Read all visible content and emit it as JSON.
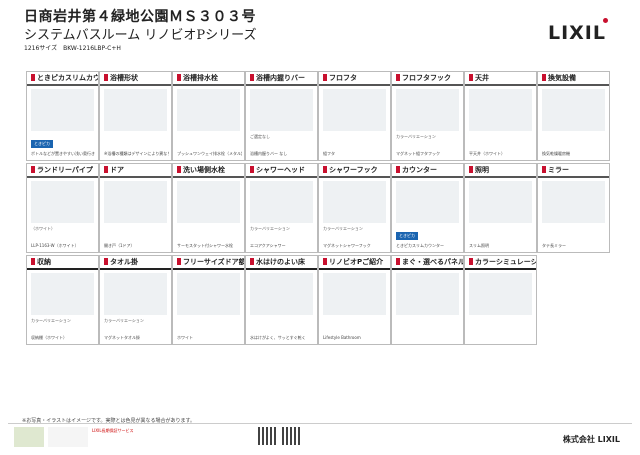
{
  "header": {
    "line1": "日商岩井第４緑地公園ＭＳ３０３号",
    "line2": "システムバスルーム リノビオPシリーズ",
    "line3": "1216サイズ　BKW-1216LBP-C+H",
    "logo": "LIXIL"
  },
  "cards": [
    {
      "title": "ときピカスリムカウンター",
      "caption": "ボトルなどが置きやすい浅い奥行き",
      "cap2": "",
      "tag": "ときピカ"
    },
    {
      "title": "浴槽形状",
      "caption": "※浴槽の種類はデザインにより異なります",
      "cap2": "",
      "tag": ""
    },
    {
      "title": "浴槽排水栓",
      "caption": "プッシュワンウェイ排水栓（メタル調）",
      "cap2": "",
      "tag": ""
    },
    {
      "title": "浴槽内握りバー",
      "caption": "浴槽内握りバー なし",
      "cap2": "ご選定なし",
      "tag": ""
    },
    {
      "title": "フロフタ",
      "caption": "組フタ",
      "cap2": "",
      "tag": ""
    },
    {
      "title": "フロフタフック",
      "caption": "マグネット組フタフック",
      "cap2": "カラーバリエーション",
      "tag": ""
    },
    {
      "title": "天井",
      "caption": "平天井（ホワイト）",
      "cap2": "",
      "tag": ""
    },
    {
      "title": "換気設備",
      "caption": "換気乾燥暖房機",
      "cap2": "",
      "tag": ""
    },
    {
      "title": "ランドリーパイプ",
      "caption": "LLP-1163-W（ホワイト）",
      "cap2": "（ホワイト）",
      "tag": ""
    },
    {
      "title": "ドア",
      "caption": "開き戸（1ドア）",
      "cap2": "",
      "tag": ""
    },
    {
      "title": "洗い場側水栓",
      "caption": "サーモスタット付シャワー水栓",
      "cap2": "",
      "tag": ""
    },
    {
      "title": "シャワーヘッド",
      "caption": "エコアクアシャワー",
      "cap2": "カラーバリエーション",
      "tag": ""
    },
    {
      "title": "シャワーフック",
      "caption": "マグネットシャワーフック",
      "cap2": "カラーバリエーション",
      "tag": ""
    },
    {
      "title": "カウンター",
      "caption": "ときピカスリムカウンター",
      "cap2": "",
      "tag": "ときピカ"
    },
    {
      "title": "照明",
      "caption": "スリム照明",
      "cap2": "",
      "tag": ""
    },
    {
      "title": "ミラー",
      "caption": "タテ長ミラー",
      "cap2": "",
      "tag": ""
    },
    {
      "title": "収納",
      "caption": "収納棚（ホワイト）",
      "cap2": "カラーバリエーション",
      "tag": ""
    },
    {
      "title": "タオル掛",
      "caption": "マグネットタオル掛",
      "cap2": "カラーバリエーション",
      "tag": ""
    },
    {
      "title": "フリーサイズドア額縁",
      "caption": "ホワイト",
      "cap2": "",
      "tag": ""
    },
    {
      "title": "水はけのよい床",
      "caption": "水はけがよく、サッとすぐ乾く",
      "cap2": "",
      "tag": ""
    },
    {
      "title": "リノビオPご紹介",
      "caption": "Lifestyle Bathroom",
      "cap2": "",
      "tag": ""
    },
    {
      "title": "まぐ・選べるパネルッパサイト",
      "caption": "",
      "cap2": "",
      "tag": ""
    },
    {
      "title": "カラーシミュレーション",
      "caption": "",
      "cap2": "",
      "tag": ""
    }
  ],
  "note": "※お写真・イラストはイメージです。実際とは色見が異なる場合があります。",
  "footer": {
    "company": "株式会社 LIXIL",
    "service": "LIXIL長期保証サービス"
  }
}
